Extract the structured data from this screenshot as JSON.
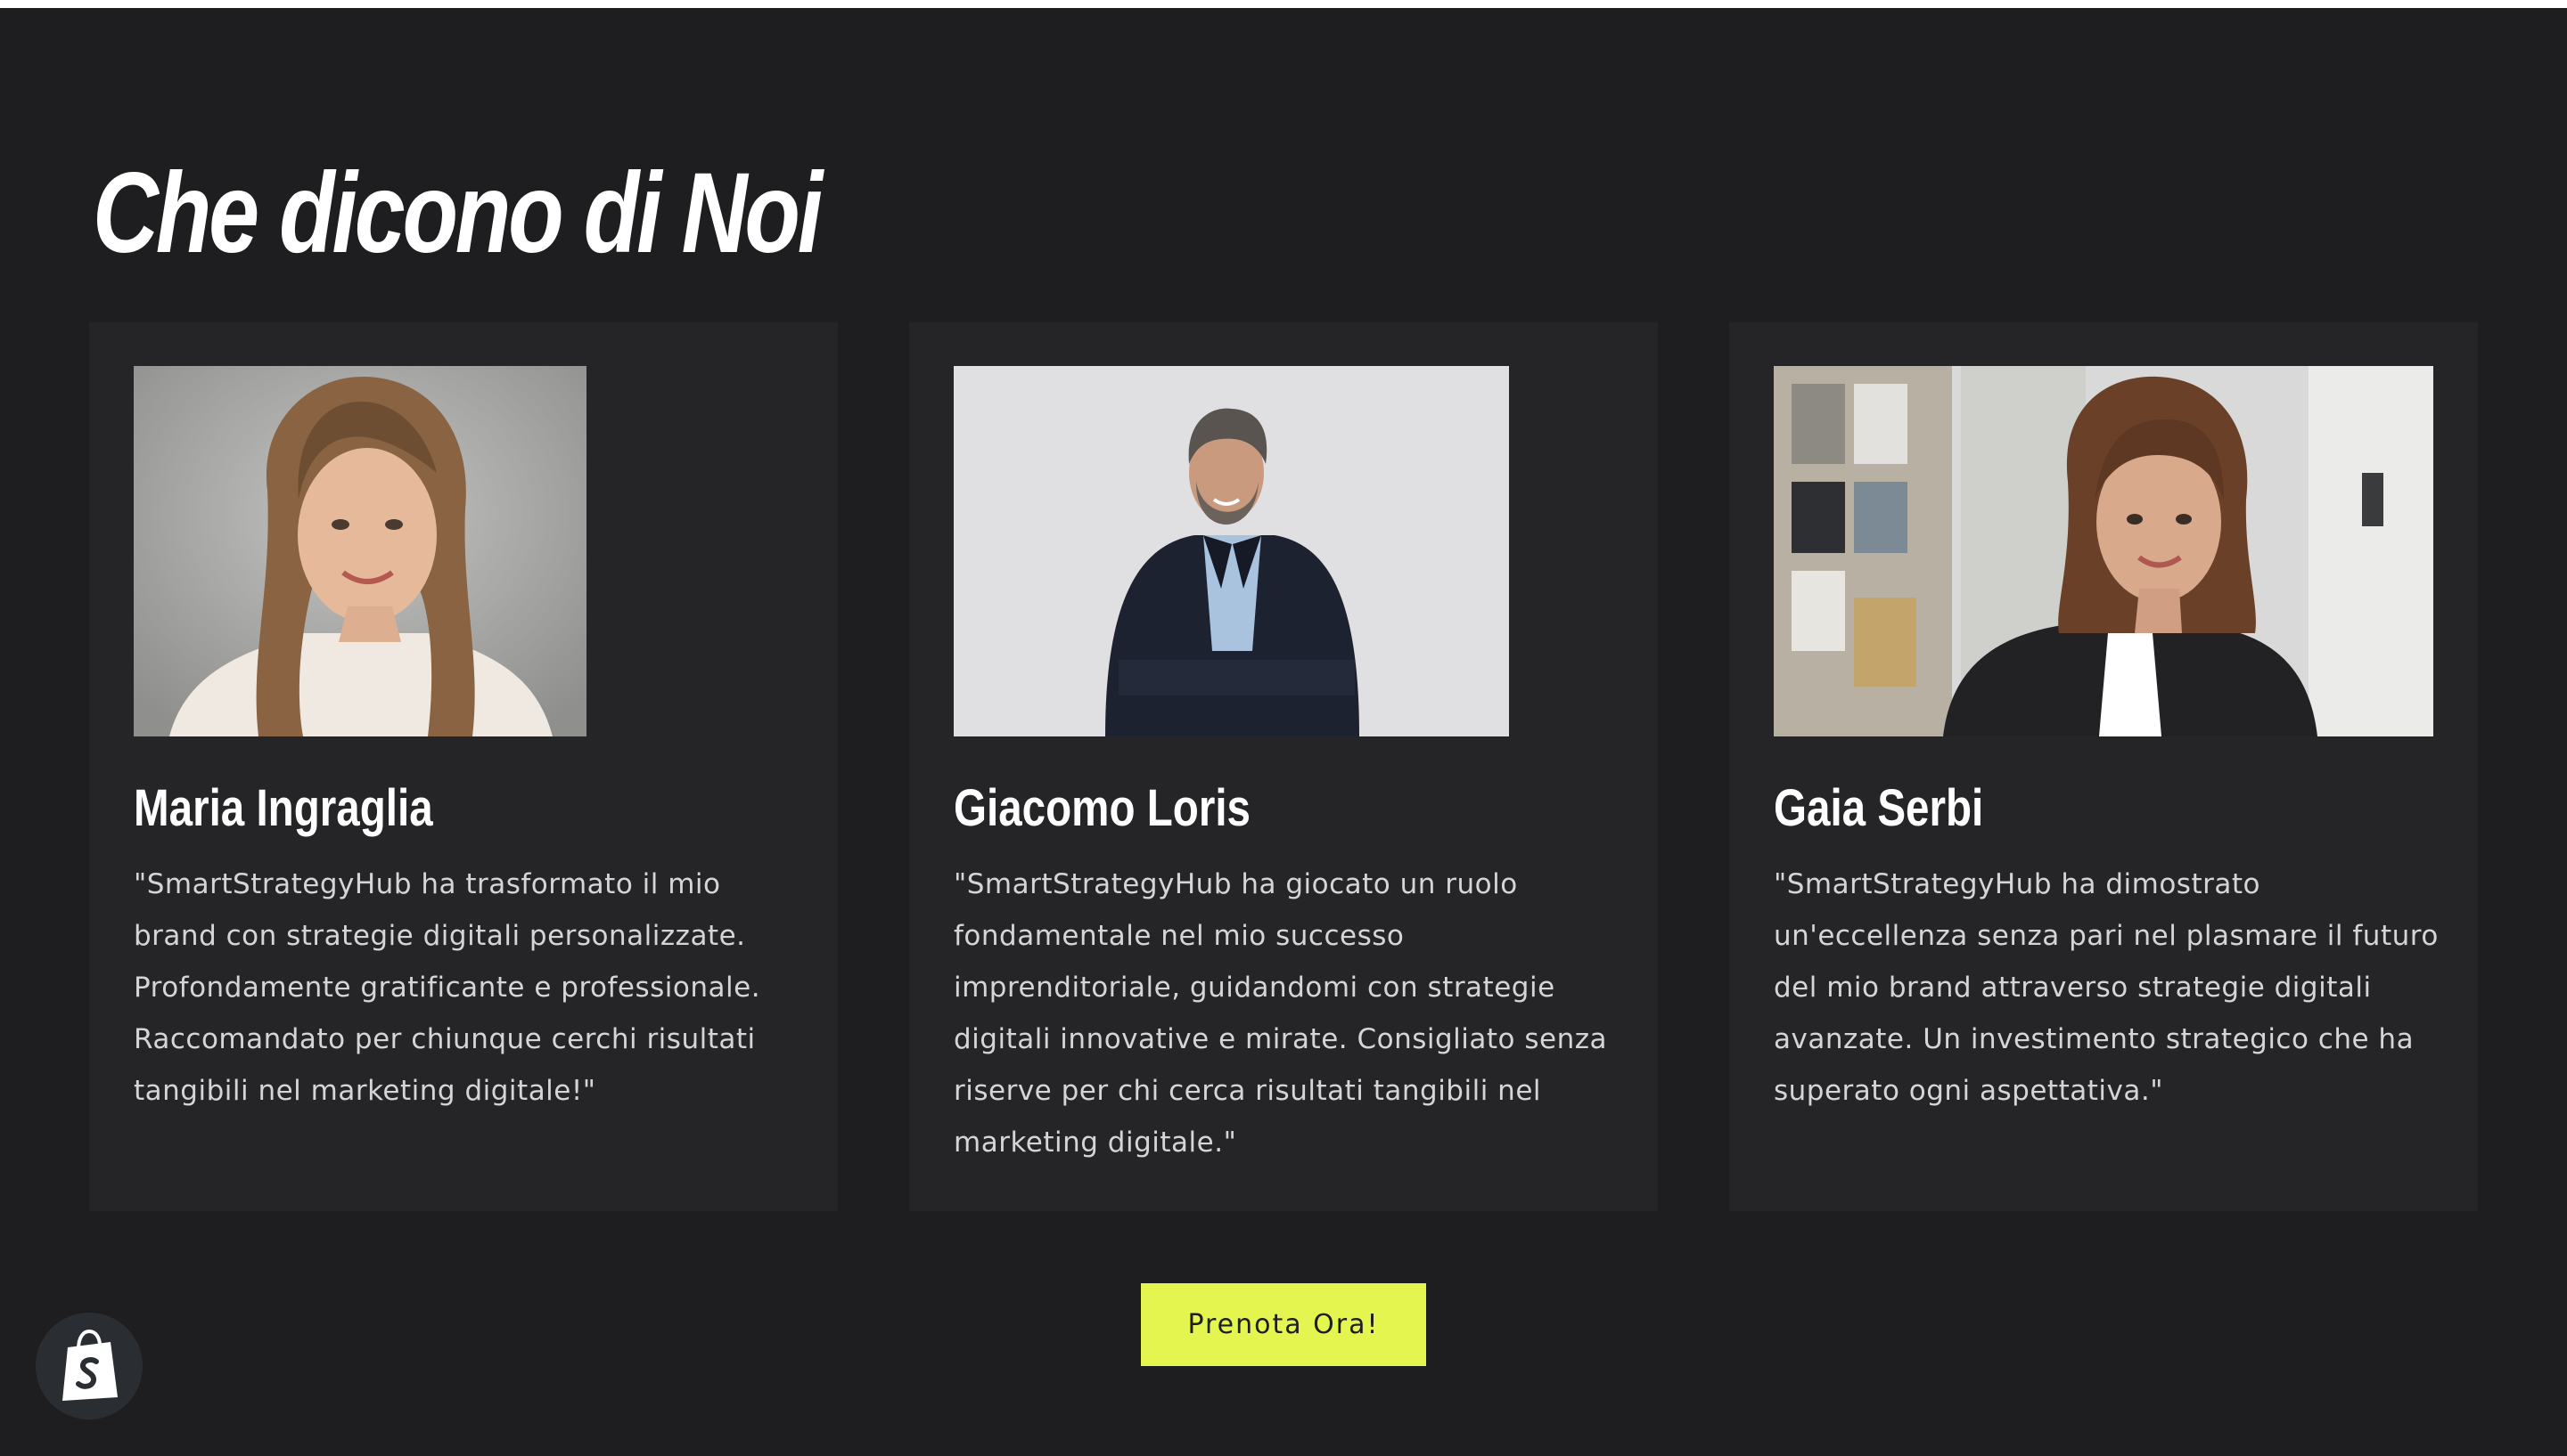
{
  "section": {
    "title": "Che dicono di Noi"
  },
  "testimonials": [
    {
      "name": "Maria Ingraglia",
      "quote": "\"SmartStrategyHub ha trasformato il mio brand con strategie digitali personalizzate. Profondamente gratificante e professionale. Raccomandato per chiunque cerchi risultati tangibili nel marketing digitale!\""
    },
    {
      "name": "Giacomo Loris",
      "quote": "\"SmartStrategyHub ha giocato un ruolo fondamentale nel mio successo imprenditoriale, guidandomi con strategie digitali innovative e mirate. Consigliato senza riserve per chi cerca risultati tangibili nel marketing digitale.\""
    },
    {
      "name": "Gaia Serbi",
      "quote": "\"SmartStrategyHub ha dimostrato un'eccellenza senza pari nel plasmare il futuro del mio brand attraverso strategie digitali avanzate. Un investimento strategico che ha superato ogni aspettativa.\""
    }
  ],
  "cta": {
    "label": "Prenota Ora!"
  },
  "colors": {
    "background": "#1e1e21",
    "card": "#252528",
    "accent": "#e4f54f",
    "text": "#ffffff",
    "body_text": "#d5d5d8"
  },
  "icons": {
    "shop_badge": "shopify-bag-icon"
  }
}
